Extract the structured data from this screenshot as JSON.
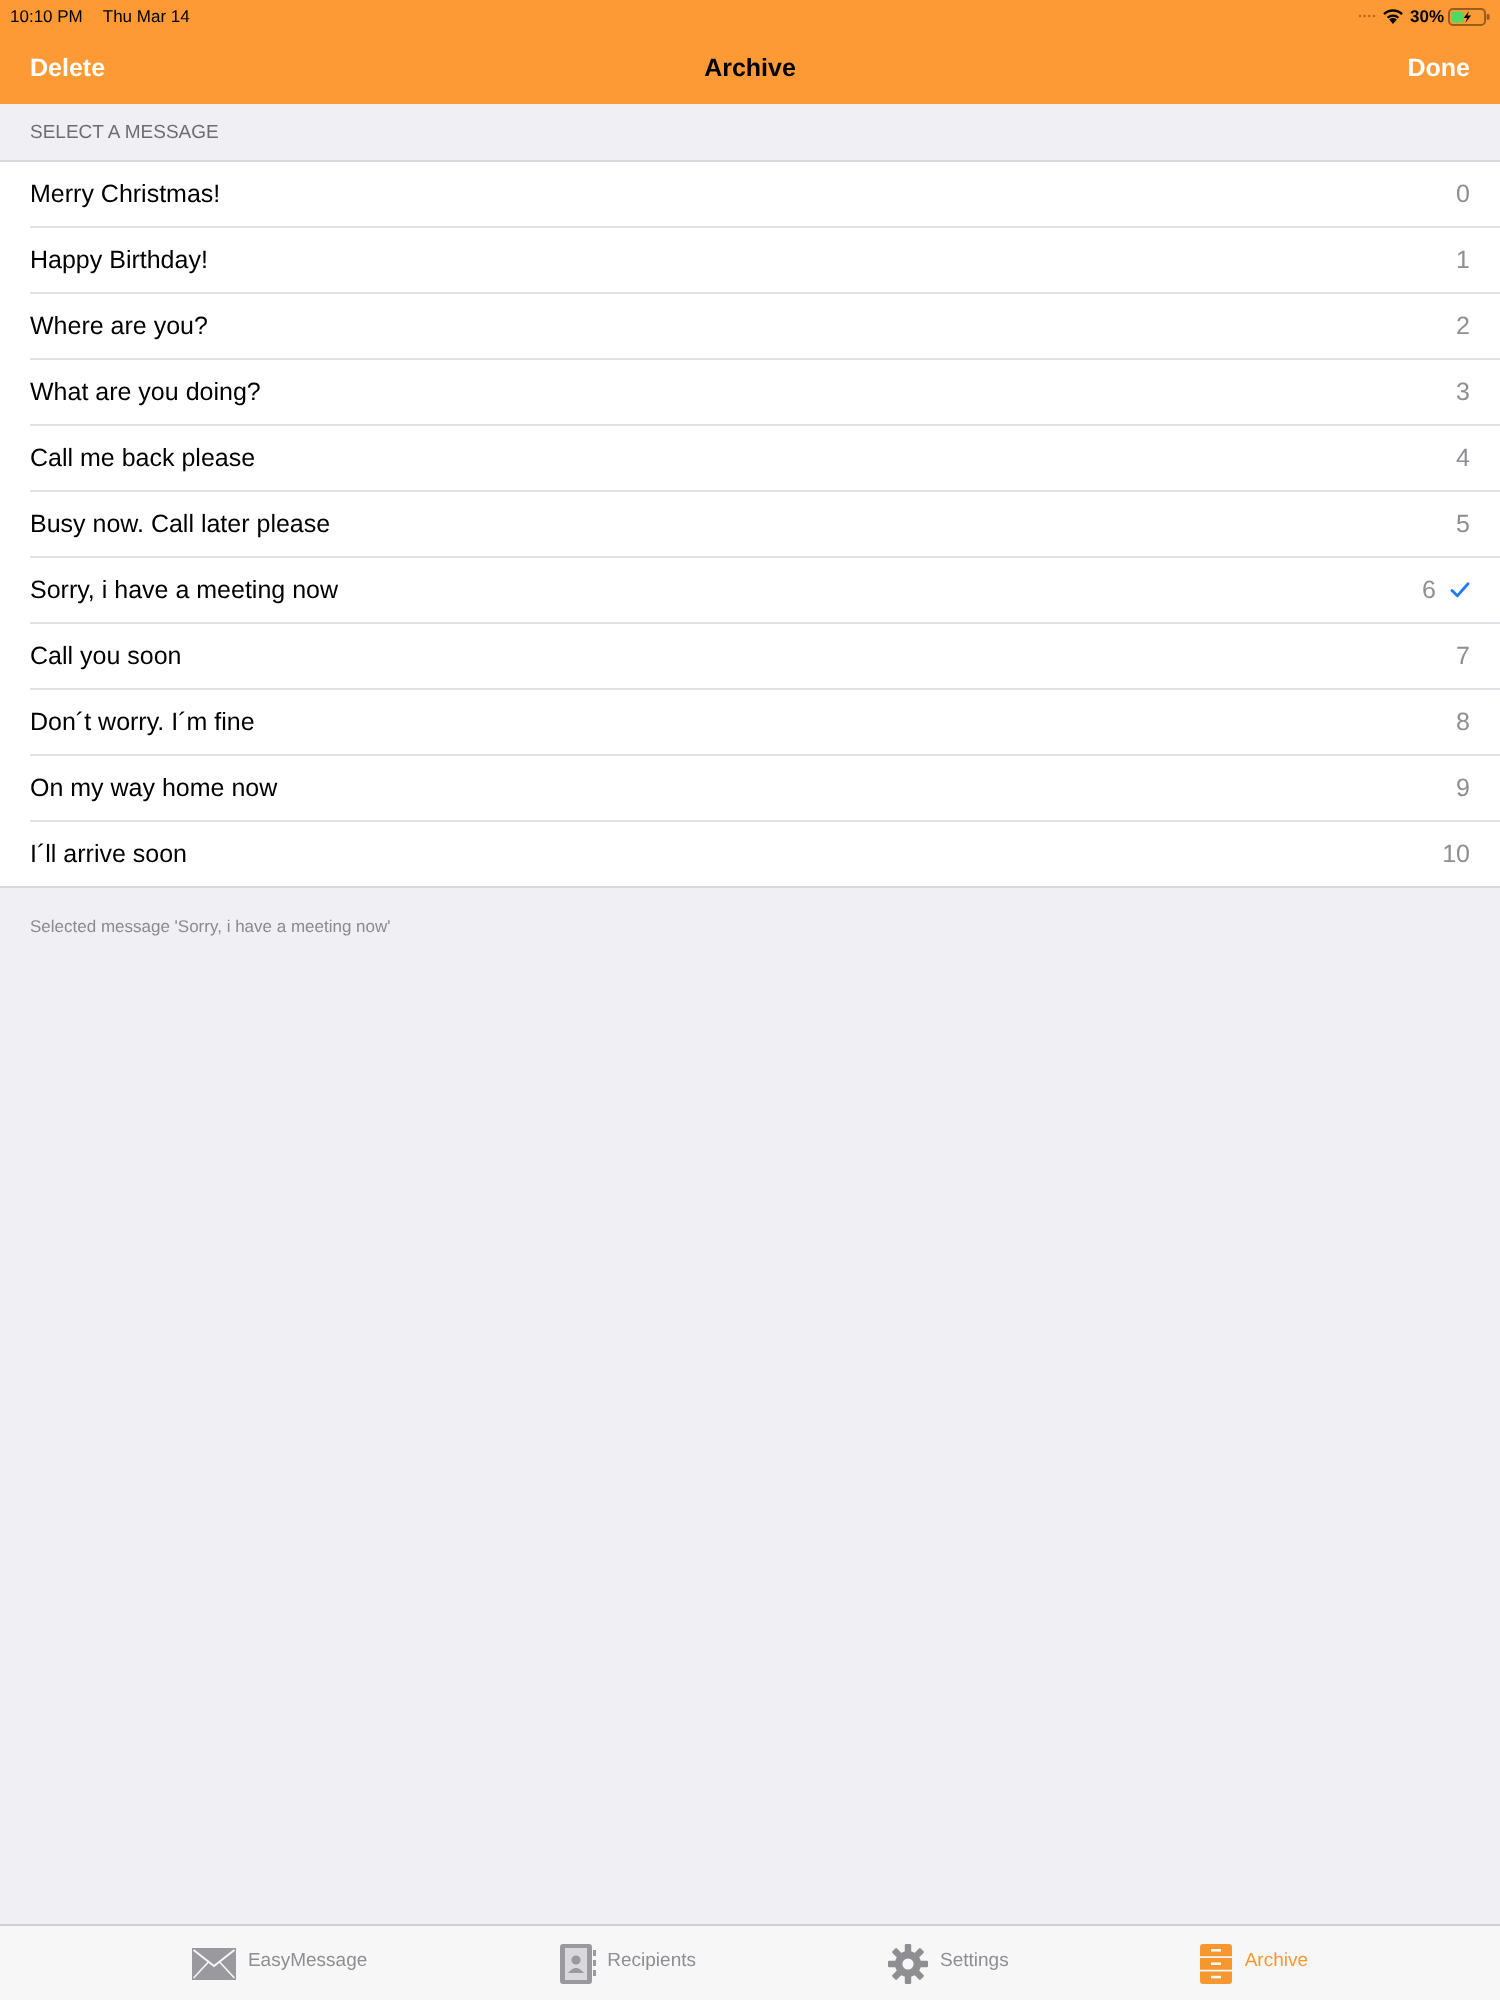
{
  "status_bar": {
    "time": "10:10 PM",
    "date": "Thu Mar 14",
    "battery": "30%"
  },
  "nav_bar": {
    "left_button": "Delete",
    "title": "Archive",
    "right_button": "Done"
  },
  "section_header": "SELECT A MESSAGE",
  "messages": [
    {
      "text": "Merry Christmas!",
      "number": "0",
      "selected": false
    },
    {
      "text": "Happy Birthday!",
      "number": "1",
      "selected": false
    },
    {
      "text": "Where are you?",
      "number": "2",
      "selected": false
    },
    {
      "text": "What are you doing?",
      "number": "3",
      "selected": false
    },
    {
      "text": "Call me back please",
      "number": "4",
      "selected": false
    },
    {
      "text": "Busy now. Call later please",
      "number": "5",
      "selected": false
    },
    {
      "text": "Sorry, i have a meeting now",
      "number": "6",
      "selected": true
    },
    {
      "text": "Call you soon",
      "number": "7",
      "selected": false
    },
    {
      "text": "Don´t worry. I´m fine",
      "number": "8",
      "selected": false
    },
    {
      "text": "On my way home now",
      "number": "9",
      "selected": false
    },
    {
      "text": "I´ll arrive soon",
      "number": "10",
      "selected": false
    }
  ],
  "footer": "Selected message 'Sorry, i have a meeting now'",
  "tab_bar": [
    {
      "label": "EasyMessage",
      "selected": false
    },
    {
      "label": "Recipients",
      "selected": false
    },
    {
      "label": "Settings",
      "selected": false
    },
    {
      "label": "Archive",
      "selected": true
    }
  ]
}
